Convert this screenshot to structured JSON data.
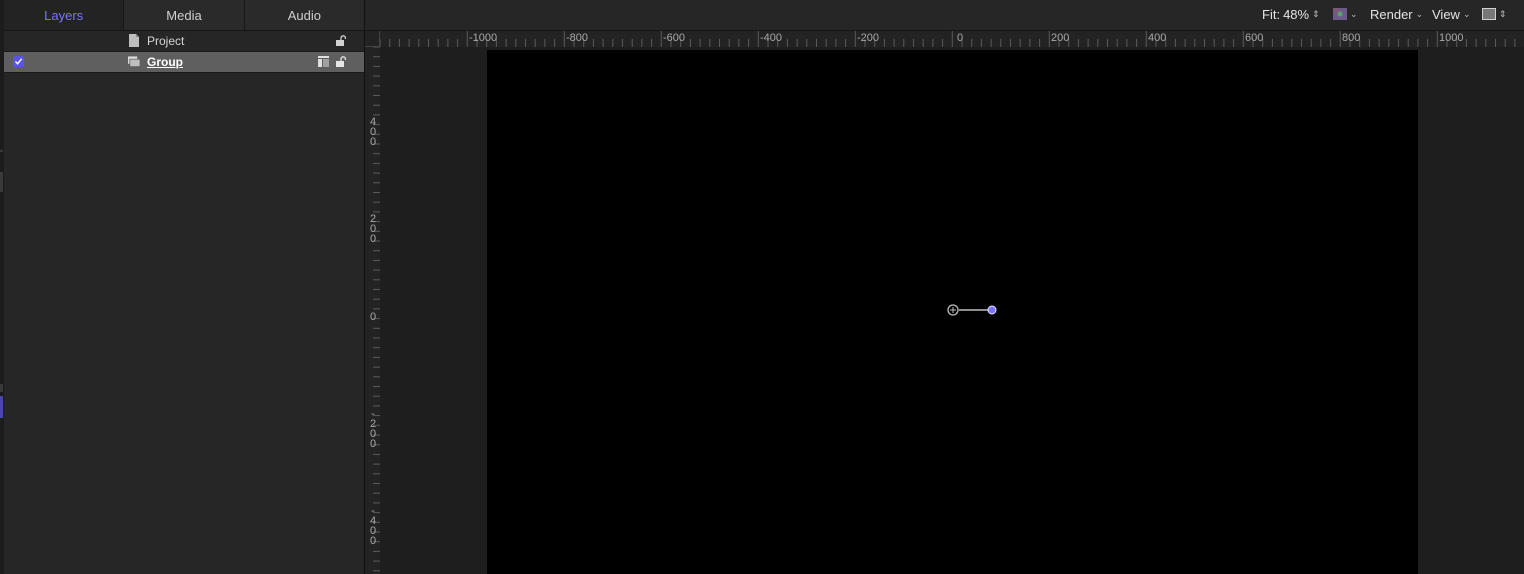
{
  "tabs": [
    {
      "label": "Layers",
      "active": true
    },
    {
      "label": "Media",
      "active": false
    },
    {
      "label": "Audio",
      "active": false
    }
  ],
  "layers": [
    {
      "name": "Project",
      "icon": "document-icon",
      "locked": false
    },
    {
      "name": "Group",
      "icon": "group-icon",
      "checked": true,
      "locked": false,
      "selected": true
    }
  ],
  "toolbar": {
    "fit_label": "Fit:",
    "fit_value": "48%",
    "color_menu_icon": "color-channels-icon",
    "render_label": "Render",
    "view_label": "View",
    "layout_icon": "viewer-layout-icon"
  },
  "ruler": {
    "horizontal": [
      "-1000",
      "-800",
      "-600",
      "-400",
      "-200",
      "0",
      "200",
      "400",
      "600",
      "800",
      "1000"
    ],
    "vertical": [
      "400",
      "200",
      "0",
      "-200",
      "-400"
    ]
  },
  "colors": {
    "accent": "#7b73ff",
    "checkbox": "#5b55e6",
    "selected_row": "#5f5f5f",
    "stage": "#000000"
  }
}
